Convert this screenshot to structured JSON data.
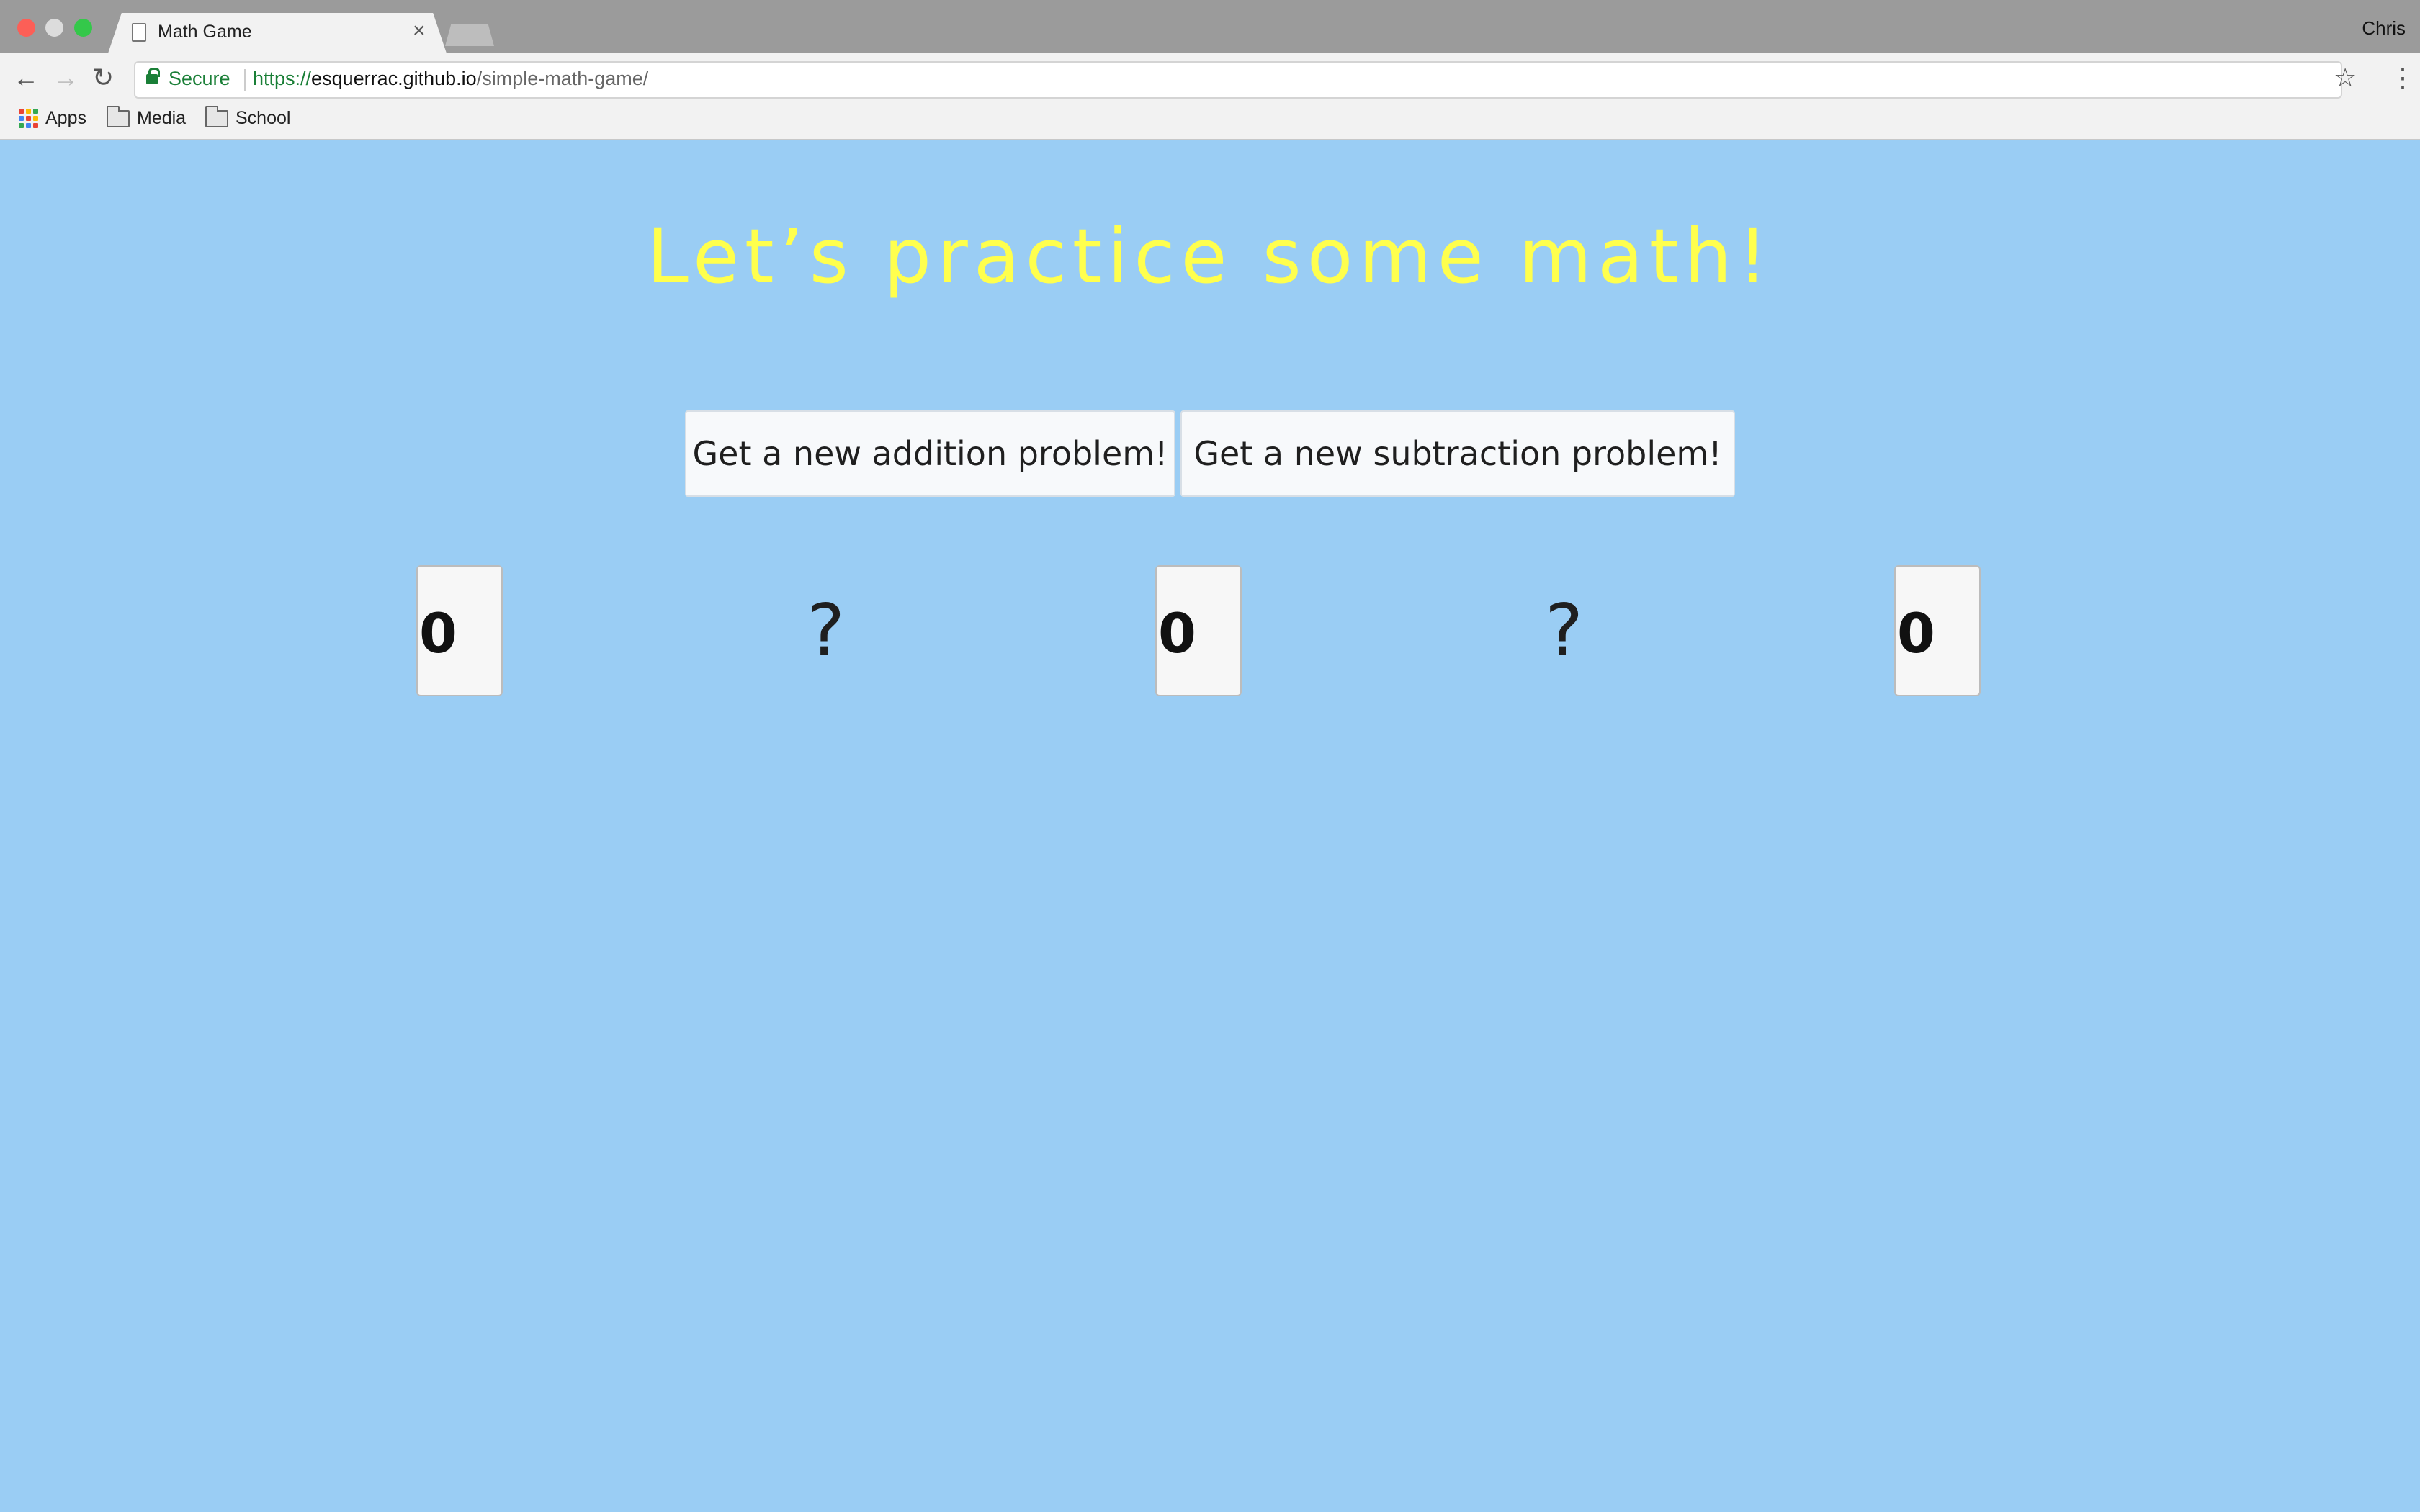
{
  "browser": {
    "tab_title": "Math Game",
    "tab_close": "×",
    "profile_name": "Chris",
    "secure_label": "Secure",
    "url_scheme": "https://",
    "url_host": "esquerrac.github.io",
    "url_path": "/simple-math-game/",
    "bookmarks": [
      "Apps",
      "Media",
      "School"
    ],
    "icons": {
      "back": "←",
      "forward": "→",
      "reload": "↻",
      "star": "☆",
      "menu": "⋮"
    }
  },
  "page": {
    "headline": "Let’s practice some math!",
    "buttons": {
      "addition": "Get a new addition problem!",
      "subtraction": "Get a new subtraction problem!"
    },
    "equation": {
      "operand1": "0",
      "operator": "?",
      "operand2": "0",
      "equals": "?",
      "answer": "0"
    }
  },
  "colors": {
    "background": "#9ACDF4",
    "headline": "#FFFF4D"
  }
}
